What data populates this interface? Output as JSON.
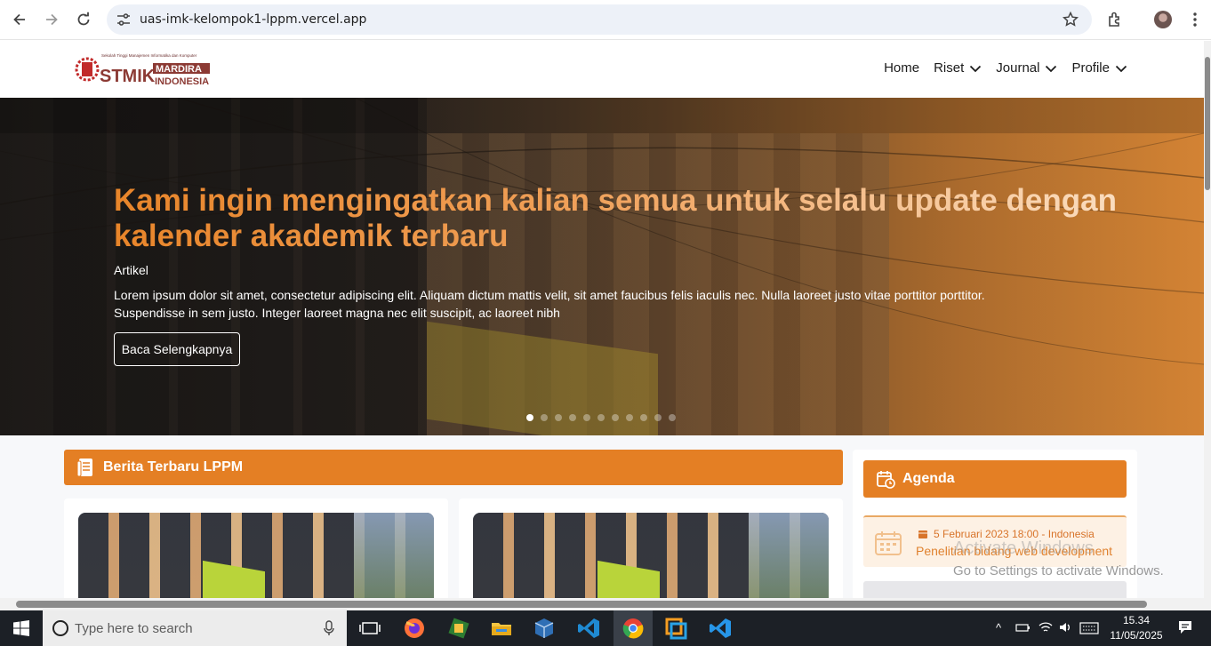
{
  "browser": {
    "url": "uas-imk-kelompok1-lppm.vercel.app",
    "back_icon": "arrow-left-icon",
    "forward_icon": "arrow-right-icon",
    "reload_icon": "reload-icon"
  },
  "site": {
    "logo_small": "Sekolah Tinggi Manajemen Informatika dan Komputer",
    "logo_main": "STMIK",
    "logo_right_top": "MARDIRA",
    "logo_right_bottom": "INDONESIA",
    "nav": [
      {
        "label": "Home",
        "has_dropdown": false
      },
      {
        "label": "Riset",
        "has_dropdown": true
      },
      {
        "label": "Journal",
        "has_dropdown": true
      },
      {
        "label": "Profile",
        "has_dropdown": true
      }
    ]
  },
  "hero": {
    "title": "Kami ingin mengingatkan kalian semua untuk selalu update dengan kalender akademik terbaru",
    "tag": "Artikel",
    "description": "Lorem ipsum dolor sit amet, consectetur adipiscing elit. Aliquam dictum mattis velit, sit amet faucibus felis iaculis nec. Nulla laoreet justo vitae porttitor porttitor. Suspendisse in sem justo. Integer laoreet magna nec elit suscipit, ac laoreet nibh",
    "cta": "Baca Selengkapnya",
    "slide_count": 11,
    "active_slide": 1,
    "bg_sign_text": "Sekolah Tinggi Manajemen Informatika dan Komputer"
  },
  "news": {
    "heading": "Berita Terbaru LPPM",
    "icon": "newspaper-icon"
  },
  "agenda": {
    "heading": "Agenda",
    "icon": "calendar-clock-icon",
    "items": [
      {
        "date": "5 Februari 2023 18:00 - Indonesia",
        "title": "Penelitian bidang web development"
      }
    ]
  },
  "watermark": {
    "line1": "Activate Windows",
    "line2": "Go to Settings to activate Windows."
  },
  "taskbar": {
    "search_placeholder": "Type here to search",
    "time": "15.34",
    "date": "11/05/2025"
  },
  "colors": {
    "accent": "#e47f24",
    "agenda_bg": "#fdf1e4"
  }
}
